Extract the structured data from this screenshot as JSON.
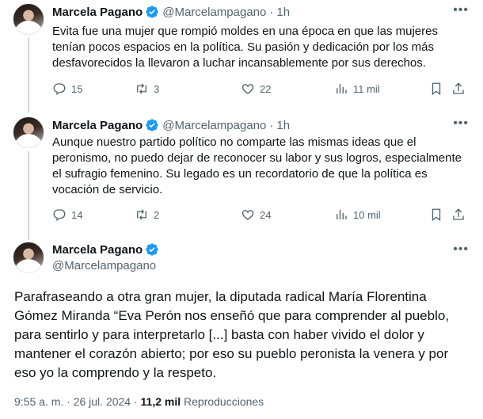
{
  "tweets": [
    {
      "author": "Marcela Pagano",
      "handle": "@Marcelampagano",
      "time": "1h",
      "text": "Evita fue una mujer que rompió moldes en una época en que las mujeres tenían pocos espacios en la política. Su pasión y dedicación por los más desfavorecidos la llevaron a luchar incansablemente por sus derechos.",
      "replies": "15",
      "retweets": "3",
      "likes": "22",
      "views": "11 mil"
    },
    {
      "author": "Marcela Pagano",
      "handle": "@Marcelampagano",
      "time": "1h",
      "text": "Aunque nuestro partido político no comparte las mismas ideas que el peronismo, no puedo dejar de reconocer su labor y sus logros, especialmente el sufragio femenino. Su legado es un recordatorio de que la política es vocación de servicio.",
      "replies": "14",
      "retweets": "2",
      "likes": "24",
      "views": "10 mil"
    }
  ],
  "main_tweet": {
    "author": "Marcela Pagano",
    "handle": "@Marcelampagano",
    "text": "Parafraseando a otra gran mujer, la diputada radical María Florentina Gómez Miranda “Eva Perón nos enseñó que para comprender al pueblo, para sentirlo y para interpretarlo [...] basta con haber vivido el dolor y mantener el corazón abierto; por eso su pueblo peronista la venera y por eso yo la comprendo y la respeto.",
    "timestamp": "9:55 a. m. · 26 jul. 2024 · ",
    "views_count": "11,2 mil",
    "views_label": " Reproducciones"
  },
  "colors": {
    "verified": "#1d9bf0",
    "muted": "#536471",
    "text": "#0f1419"
  },
  "icons": [
    "verified-badge-icon",
    "more-icon",
    "reply-icon",
    "retweet-icon",
    "like-icon",
    "views-icon",
    "bookmark-icon",
    "share-icon"
  ]
}
